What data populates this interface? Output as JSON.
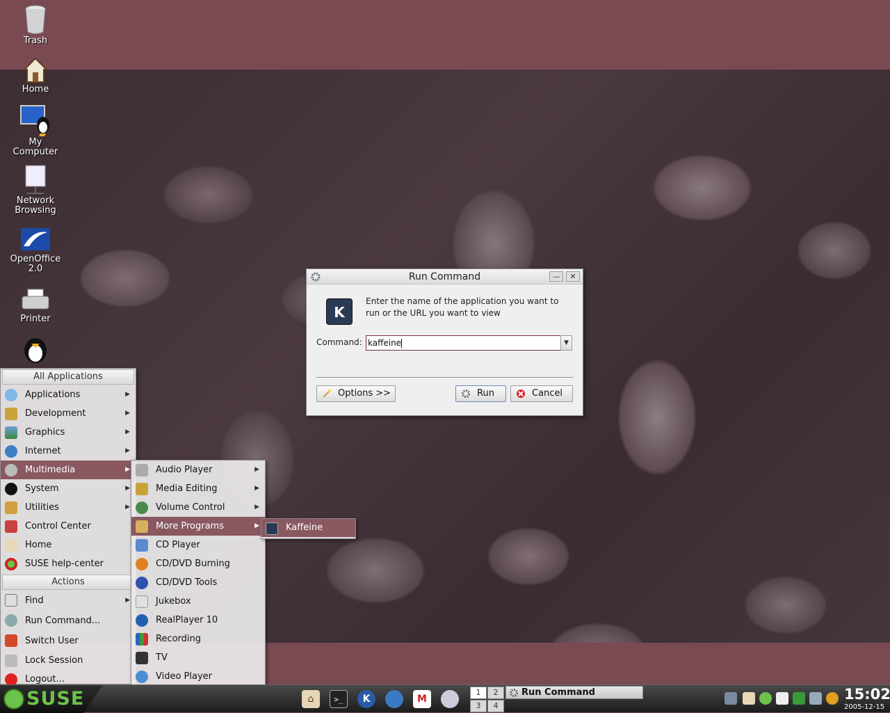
{
  "desktop": {
    "icons": [
      {
        "label": "Trash",
        "icon": "trash-icon"
      },
      {
        "label": "Home",
        "icon": "home-icon"
      },
      {
        "label": "My Computer",
        "icon": "computer-icon"
      },
      {
        "label": "Network Browsing",
        "icon": "network-icon"
      },
      {
        "label": "OpenOffice 2.0",
        "icon": "openoffice-icon"
      },
      {
        "label": "Printer",
        "icon": "printer-icon"
      },
      {
        "label": "",
        "icon": "tux-icon"
      }
    ]
  },
  "dialog": {
    "title": "Run Command",
    "prompt": "Enter the name of the application you want to run or the URL you want to view",
    "command_label": "Command:",
    "command_value": "kaffeine",
    "options_label": "Options >>",
    "run_label": "Run",
    "cancel_label": "Cancel",
    "close_glyph": "✕",
    "minimize_glyph": "—"
  },
  "start_menu": {
    "all_apps_header": "All Applications",
    "items": [
      {
        "label": "Applications",
        "icon": "applications-icon",
        "submenu": true
      },
      {
        "label": "Development",
        "icon": "development-icon",
        "submenu": true
      },
      {
        "label": "Graphics",
        "icon": "graphics-icon",
        "submenu": true
      },
      {
        "label": "Internet",
        "icon": "internet-icon",
        "submenu": true
      },
      {
        "label": "Multimedia",
        "icon": "multimedia-icon",
        "submenu": true,
        "active": true
      },
      {
        "label": "System",
        "icon": "system-icon",
        "submenu": true
      },
      {
        "label": "Utilities",
        "icon": "utilities-icon",
        "submenu": true
      },
      {
        "label": "Control Center",
        "icon": "control-center-icon",
        "submenu": false
      },
      {
        "label": "Home",
        "icon": "home-icon",
        "submenu": false
      },
      {
        "label": "SUSE help-center",
        "icon": "help-icon",
        "submenu": false
      }
    ],
    "actions_header": "Actions",
    "actions": [
      {
        "label": "Find",
        "icon": "find-icon",
        "submenu": true
      },
      {
        "label": "Run Command...",
        "icon": "run-icon",
        "submenu": false
      },
      {
        "label": "Switch User",
        "icon": "switch-user-icon",
        "submenu": false
      },
      {
        "label": "Lock Session",
        "icon": "lock-icon",
        "submenu": false
      },
      {
        "label": "Logout...",
        "icon": "logout-icon",
        "submenu": false
      }
    ]
  },
  "multimedia_menu": {
    "items": [
      {
        "label": "Audio Player",
        "submenu": true
      },
      {
        "label": "Media Editing",
        "submenu": true
      },
      {
        "label": "Volume Control",
        "submenu": true
      },
      {
        "label": "More Programs",
        "submenu": true,
        "active": true
      },
      {
        "label": "CD Player",
        "submenu": false
      },
      {
        "label": "CD/DVD Burning",
        "submenu": false
      },
      {
        "label": "CD/DVD Tools",
        "submenu": false
      },
      {
        "label": "Jukebox",
        "submenu": false
      },
      {
        "label": "RealPlayer 10",
        "submenu": false
      },
      {
        "label": "Recording",
        "submenu": false
      },
      {
        "label": "TV",
        "submenu": false
      },
      {
        "label": "Video Player",
        "submenu": false
      }
    ]
  },
  "more_programs_menu": {
    "items": [
      {
        "label": "Kaffeine"
      }
    ]
  },
  "taskbar": {
    "brand": "SUSE",
    "pager": [
      "1",
      "2",
      "3",
      "4"
    ],
    "task_title": "Run Command",
    "time": "15:02",
    "date": "2005-12-15"
  }
}
